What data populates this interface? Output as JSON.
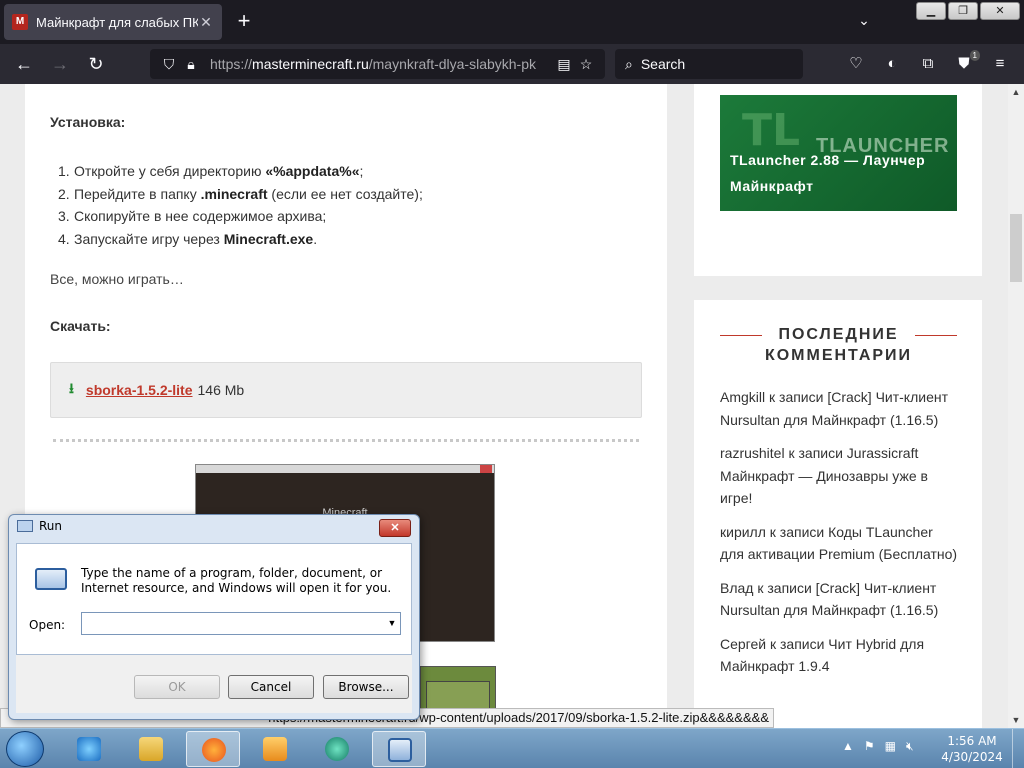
{
  "browser": {
    "tab": {
      "title": "Майнкрафт для слабых ПК - M",
      "favicon_letter": "M"
    },
    "newtab_label": "+",
    "url": {
      "scheme": "https://",
      "domain": "masterminecraft.ru",
      "path": "/maynkraft-dlya-slabykh-pk"
    },
    "search": {
      "placeholder": "Search"
    },
    "extensions_badge": "1"
  },
  "article": {
    "install_heading": "Установка:",
    "steps": [
      {
        "num": "1.",
        "pre": "Откройте у себя директорию ",
        "bold": "«%appdata%«",
        "post": ";"
      },
      {
        "num": "2.",
        "pre": "Перейдите в папку ",
        "bold": ".minecraft",
        "post": " (если ее нет создайте);"
      },
      {
        "num": "3.",
        "pre": "Скопируйте в нее содержимое архива;",
        "bold": "",
        "post": ""
      },
      {
        "num": "4.",
        "pre": "Запускайте игру через ",
        "bold": "Minecraft.exe",
        "post": "."
      }
    ],
    "all_ok": "Все, можно играть…",
    "download_heading": "Скачать:",
    "download": {
      "link": "sborka-1.5.2-lite",
      "size": "146 Mb"
    },
    "screenshot_caption": "Minecraft"
  },
  "sidebar": {
    "banner": {
      "logo": "TL",
      "word": "TLAUNCHER",
      "title": "TLauncher 2.88 — Лаунчер Майнкрафт"
    },
    "comments_heading": "ПОСЛЕДНИЕ КОММЕНТАРИИ",
    "comments": [
      "Amgkill к записи [Crack] Чит-клиент Nursultan для Майнкрафт (1.16.5)",
      "razrushitel к записи Jurassicraft Майнкрафт — Динозавры уже в игре!",
      "кирилл к записи Коды TLauncher для активации Premium (Бесплатно)",
      "Влад к записи [Crack] Чит-клиент Nursultan для Майнкрафт (1.16.5)",
      "Сергей к записи Чит Hybrid для Майнкрафт 1.9.4"
    ]
  },
  "status_url": "https://masterminecraft.ru/wp-content/uploads/2017/09/sborka-1.5.2-lite.zip&&&&&&&&",
  "run_dialog": {
    "title": "Run",
    "description": "Type the name of a program, folder, document, or Internet resource, and Windows will open it for you.",
    "open_label": "Open:",
    "open_value": "",
    "ok": "OK",
    "cancel": "Cancel",
    "browse": "Browse..."
  },
  "taskbar": {
    "time": "1:56 AM",
    "date": "4/30/2024"
  },
  "colors": {
    "accent_red": "#c0392b",
    "download_green": "#1f8a2f",
    "banner_green": "#1c7a3a"
  }
}
